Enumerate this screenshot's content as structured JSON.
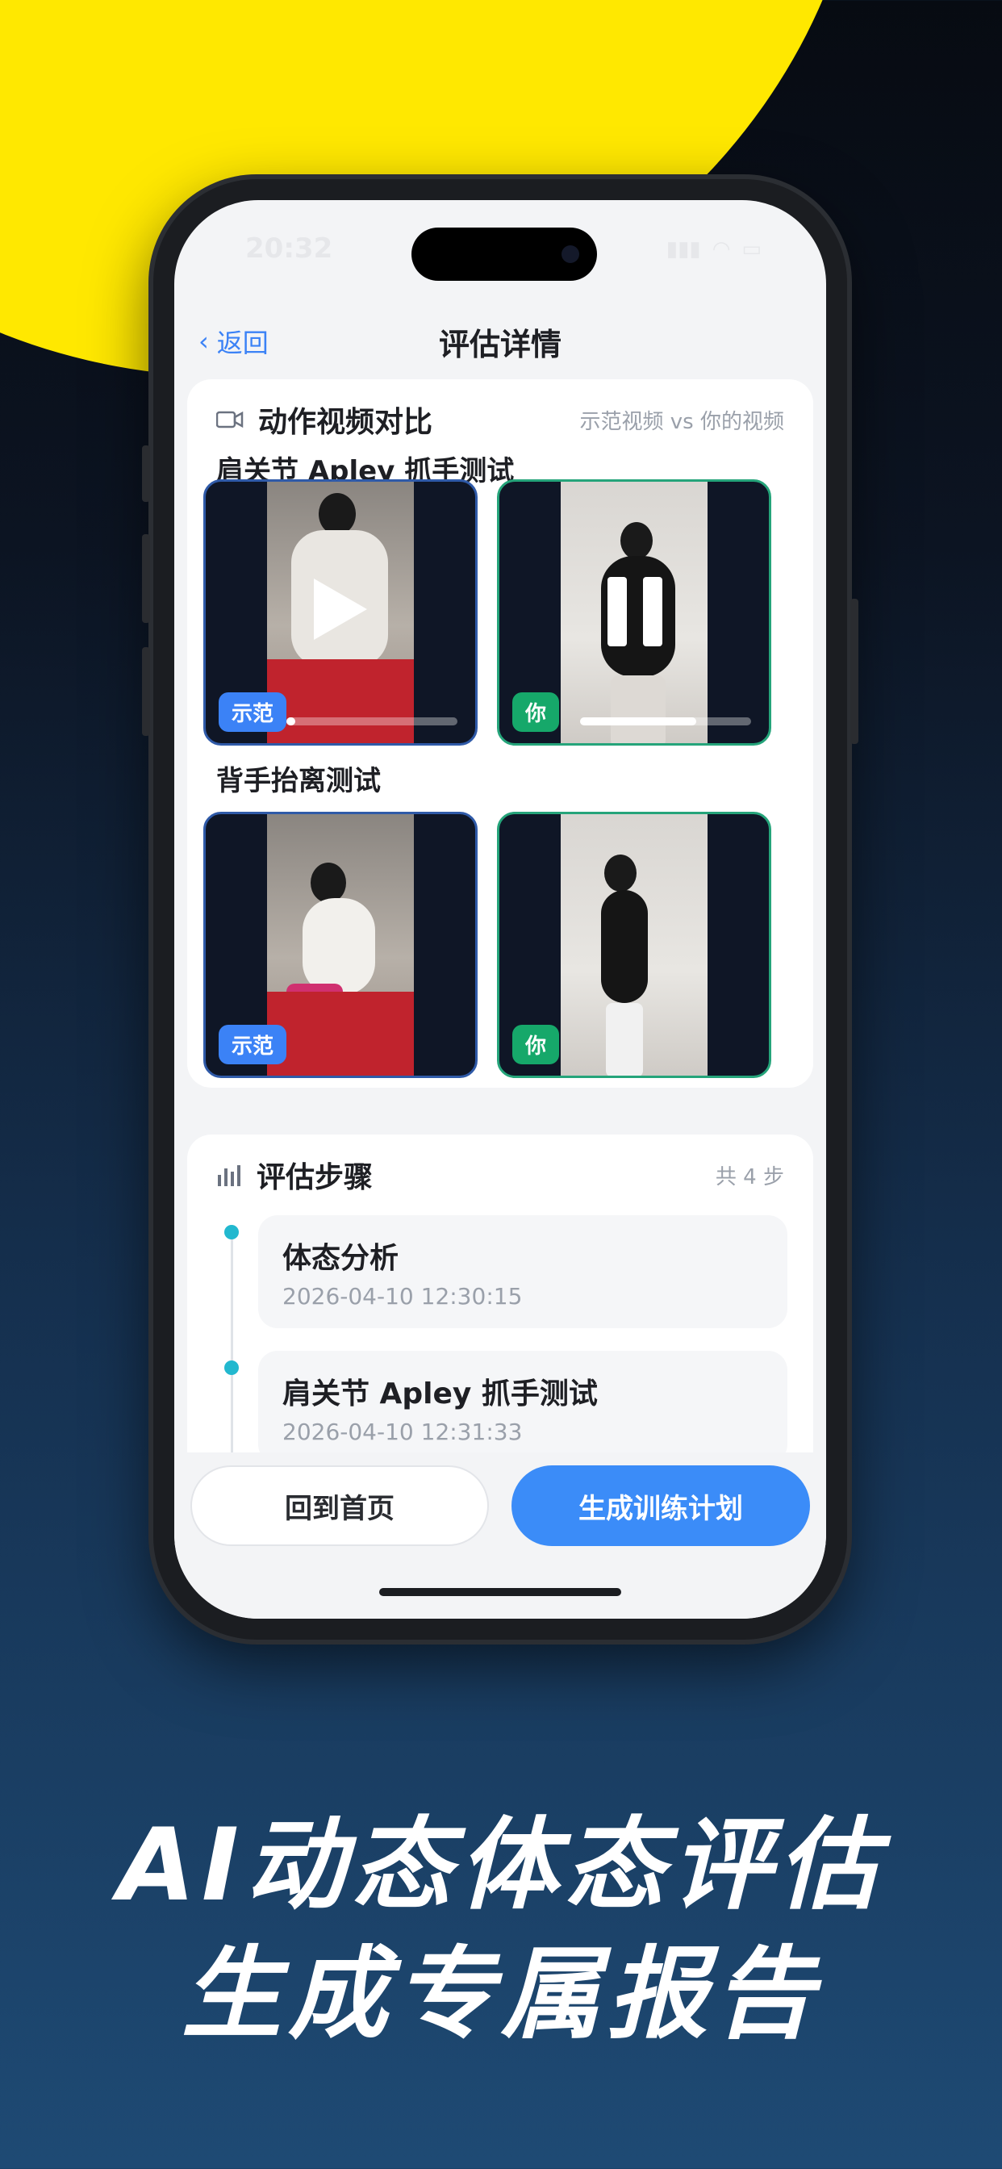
{
  "status_bar": {
    "time": "20:32"
  },
  "nav": {
    "back_label": "返回",
    "title": "评估详情"
  },
  "video_card": {
    "title": "动作视频对比",
    "subtitle": "示范视频 vs 你的视频",
    "tests": [
      {
        "name": "肩关节 Apley 抓手测试",
        "demo_badge": "示范",
        "mine_badge": "你",
        "demo_progress": 0.05,
        "mine_progress": 0.68
      },
      {
        "name": "背手抬离测试",
        "demo_badge": "示范",
        "mine_badge": "你"
      }
    ]
  },
  "steps_card": {
    "title": "评估步骤",
    "count_label": "共 4 步",
    "steps": [
      {
        "name": "体态分析",
        "time": "2026-04-10 12:30:15"
      },
      {
        "name": "肩关节 Apley 抓手测试",
        "time": "2026-04-10 12:31:33"
      }
    ]
  },
  "actions": {
    "home_label": "回到首页",
    "plan_label": "生成训练计划"
  },
  "headline": {
    "line1": "AI动态体态评估",
    "line2": "生成专属报告"
  },
  "colors": {
    "accent": "#3b8cf8",
    "demo_badge": "#3b82f6",
    "mine_badge": "#16a86a",
    "brand_yellow": "#ffe800"
  }
}
